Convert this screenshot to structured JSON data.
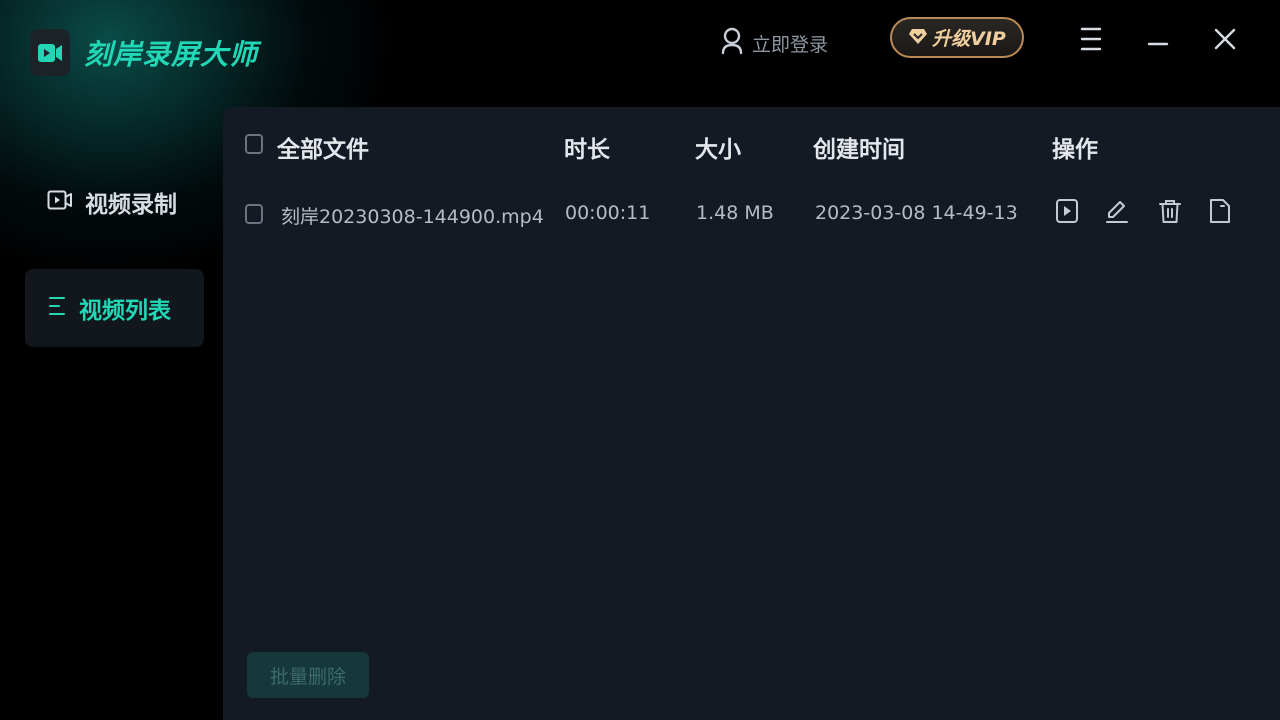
{
  "app": {
    "name": "刻岸录屏大师",
    "login_label": "立即登录",
    "vip_label": "升级VIP"
  },
  "sidebar": {
    "items": [
      {
        "label": "视频录制",
        "icon": "video-record-icon",
        "active": false
      },
      {
        "label": "视频列表",
        "icon": "list-icon",
        "active": true
      }
    ]
  },
  "table": {
    "columns": [
      "全部文件",
      "时长",
      "大小",
      "创建时间",
      "操作"
    ],
    "rows": [
      {
        "name": "刻岸20230308-144900.mp4",
        "duration": "00:00:11",
        "size": "1.48 MB",
        "created": "2023-03-08 14-49-13",
        "actions": [
          "play-icon",
          "edit-icon",
          "trash-icon",
          "folder-icon"
        ]
      }
    ]
  },
  "footer": {
    "batch_delete_label": "批量删除"
  },
  "colors": {
    "accent": "#21d7b6",
    "vip_gold": "#f0cf9e",
    "panel_bg": "#141a24",
    "app_bg": "#000000"
  }
}
